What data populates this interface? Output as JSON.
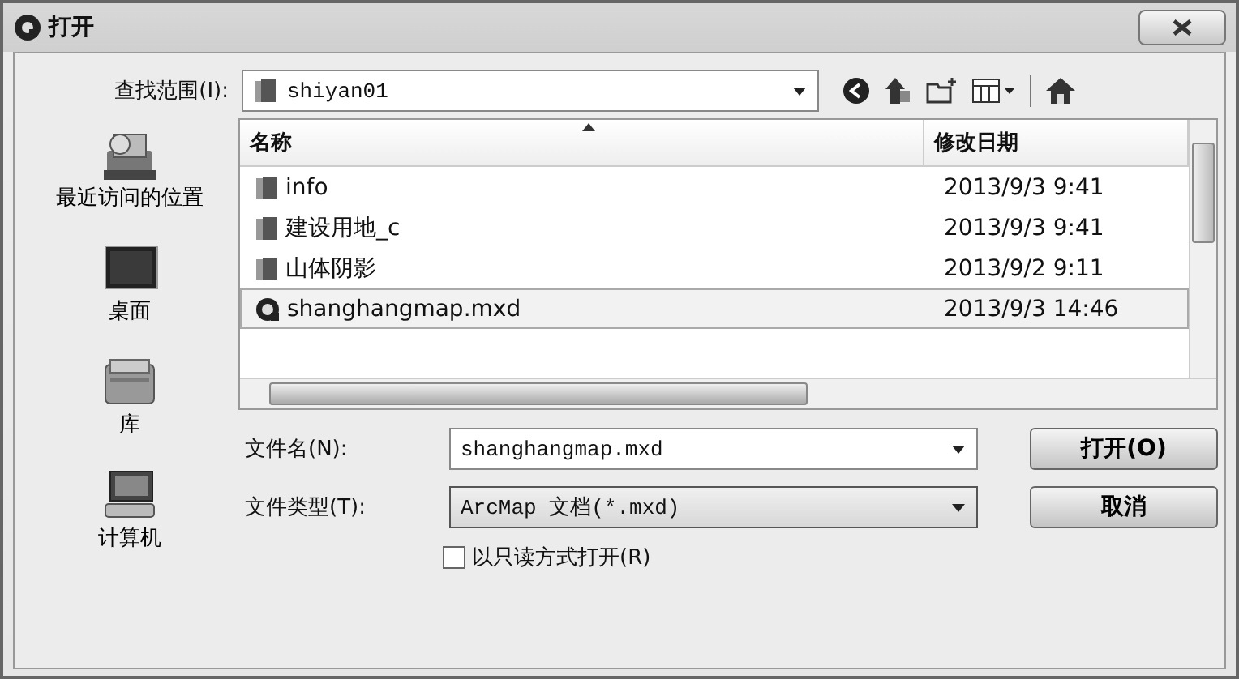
{
  "window": {
    "title": "打开"
  },
  "look_in": {
    "label": "查找范围(I):",
    "value": "shiyan01"
  },
  "places": [
    {
      "label": "最近访问的位置",
      "kind": "recent"
    },
    {
      "label": "桌面",
      "kind": "desktop"
    },
    {
      "label": "库",
      "kind": "library"
    },
    {
      "label": "计算机",
      "kind": "computer"
    }
  ],
  "file_list": {
    "columns": [
      "名称",
      "修改日期"
    ],
    "rows": [
      {
        "name": "info",
        "date": "2013/9/3 9:41",
        "kind": "folder",
        "selected": false
      },
      {
        "name": "建设用地_c",
        "date": "2013/9/3 9:41",
        "kind": "folder",
        "selected": false
      },
      {
        "name": "山体阴影",
        "date": "2013/9/2 9:11",
        "kind": "folder",
        "selected": false
      },
      {
        "name": "shanghangmap.mxd",
        "date": "2013/9/3 14:46",
        "kind": "map",
        "selected": true
      }
    ]
  },
  "file_name": {
    "label": "文件名(N):",
    "value": "shanghangmap.mxd"
  },
  "file_type": {
    "label": "文件类型(T):",
    "value": "ArcMap 文档(*.mxd)"
  },
  "read_only": {
    "label": "以只读方式打开(R)",
    "checked": false
  },
  "buttons": [
    "打开(O)",
    "取消"
  ]
}
